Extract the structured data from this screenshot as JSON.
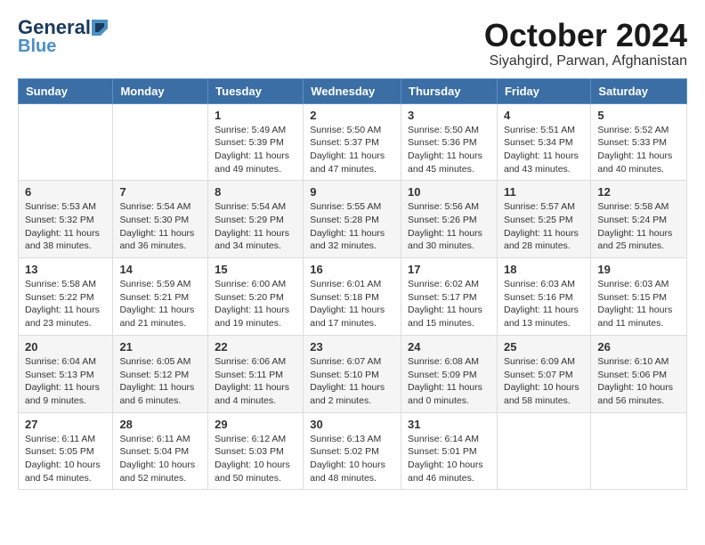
{
  "logo": {
    "general": "General",
    "blue": "Blue"
  },
  "title": "October 2024",
  "location": "Siyahgird, Parwan, Afghanistan",
  "days_of_week": [
    "Sunday",
    "Monday",
    "Tuesday",
    "Wednesday",
    "Thursday",
    "Friday",
    "Saturday"
  ],
  "weeks": [
    [
      {
        "day": "",
        "info": ""
      },
      {
        "day": "",
        "info": ""
      },
      {
        "day": "1",
        "info": "Sunrise: 5:49 AM\nSunset: 5:39 PM\nDaylight: 11 hours and 49 minutes."
      },
      {
        "day": "2",
        "info": "Sunrise: 5:50 AM\nSunset: 5:37 PM\nDaylight: 11 hours and 47 minutes."
      },
      {
        "day": "3",
        "info": "Sunrise: 5:50 AM\nSunset: 5:36 PM\nDaylight: 11 hours and 45 minutes."
      },
      {
        "day": "4",
        "info": "Sunrise: 5:51 AM\nSunset: 5:34 PM\nDaylight: 11 hours and 43 minutes."
      },
      {
        "day": "5",
        "info": "Sunrise: 5:52 AM\nSunset: 5:33 PM\nDaylight: 11 hours and 40 minutes."
      }
    ],
    [
      {
        "day": "6",
        "info": "Sunrise: 5:53 AM\nSunset: 5:32 PM\nDaylight: 11 hours and 38 minutes."
      },
      {
        "day": "7",
        "info": "Sunrise: 5:54 AM\nSunset: 5:30 PM\nDaylight: 11 hours and 36 minutes."
      },
      {
        "day": "8",
        "info": "Sunrise: 5:54 AM\nSunset: 5:29 PM\nDaylight: 11 hours and 34 minutes."
      },
      {
        "day": "9",
        "info": "Sunrise: 5:55 AM\nSunset: 5:28 PM\nDaylight: 11 hours and 32 minutes."
      },
      {
        "day": "10",
        "info": "Sunrise: 5:56 AM\nSunset: 5:26 PM\nDaylight: 11 hours and 30 minutes."
      },
      {
        "day": "11",
        "info": "Sunrise: 5:57 AM\nSunset: 5:25 PM\nDaylight: 11 hours and 28 minutes."
      },
      {
        "day": "12",
        "info": "Sunrise: 5:58 AM\nSunset: 5:24 PM\nDaylight: 11 hours and 25 minutes."
      }
    ],
    [
      {
        "day": "13",
        "info": "Sunrise: 5:58 AM\nSunset: 5:22 PM\nDaylight: 11 hours and 23 minutes."
      },
      {
        "day": "14",
        "info": "Sunrise: 5:59 AM\nSunset: 5:21 PM\nDaylight: 11 hours and 21 minutes."
      },
      {
        "day": "15",
        "info": "Sunrise: 6:00 AM\nSunset: 5:20 PM\nDaylight: 11 hours and 19 minutes."
      },
      {
        "day": "16",
        "info": "Sunrise: 6:01 AM\nSunset: 5:18 PM\nDaylight: 11 hours and 17 minutes."
      },
      {
        "day": "17",
        "info": "Sunrise: 6:02 AM\nSunset: 5:17 PM\nDaylight: 11 hours and 15 minutes."
      },
      {
        "day": "18",
        "info": "Sunrise: 6:03 AM\nSunset: 5:16 PM\nDaylight: 11 hours and 13 minutes."
      },
      {
        "day": "19",
        "info": "Sunrise: 6:03 AM\nSunset: 5:15 PM\nDaylight: 11 hours and 11 minutes."
      }
    ],
    [
      {
        "day": "20",
        "info": "Sunrise: 6:04 AM\nSunset: 5:13 PM\nDaylight: 11 hours and 9 minutes."
      },
      {
        "day": "21",
        "info": "Sunrise: 6:05 AM\nSunset: 5:12 PM\nDaylight: 11 hours and 6 minutes."
      },
      {
        "day": "22",
        "info": "Sunrise: 6:06 AM\nSunset: 5:11 PM\nDaylight: 11 hours and 4 minutes."
      },
      {
        "day": "23",
        "info": "Sunrise: 6:07 AM\nSunset: 5:10 PM\nDaylight: 11 hours and 2 minutes."
      },
      {
        "day": "24",
        "info": "Sunrise: 6:08 AM\nSunset: 5:09 PM\nDaylight: 11 hours and 0 minutes."
      },
      {
        "day": "25",
        "info": "Sunrise: 6:09 AM\nSunset: 5:07 PM\nDaylight: 10 hours and 58 minutes."
      },
      {
        "day": "26",
        "info": "Sunrise: 6:10 AM\nSunset: 5:06 PM\nDaylight: 10 hours and 56 minutes."
      }
    ],
    [
      {
        "day": "27",
        "info": "Sunrise: 6:11 AM\nSunset: 5:05 PM\nDaylight: 10 hours and 54 minutes."
      },
      {
        "day": "28",
        "info": "Sunrise: 6:11 AM\nSunset: 5:04 PM\nDaylight: 10 hours and 52 minutes."
      },
      {
        "day": "29",
        "info": "Sunrise: 6:12 AM\nSunset: 5:03 PM\nDaylight: 10 hours and 50 minutes."
      },
      {
        "day": "30",
        "info": "Sunrise: 6:13 AM\nSunset: 5:02 PM\nDaylight: 10 hours and 48 minutes."
      },
      {
        "day": "31",
        "info": "Sunrise: 6:14 AM\nSunset: 5:01 PM\nDaylight: 10 hours and 46 minutes."
      },
      {
        "day": "",
        "info": ""
      },
      {
        "day": "",
        "info": ""
      }
    ]
  ]
}
